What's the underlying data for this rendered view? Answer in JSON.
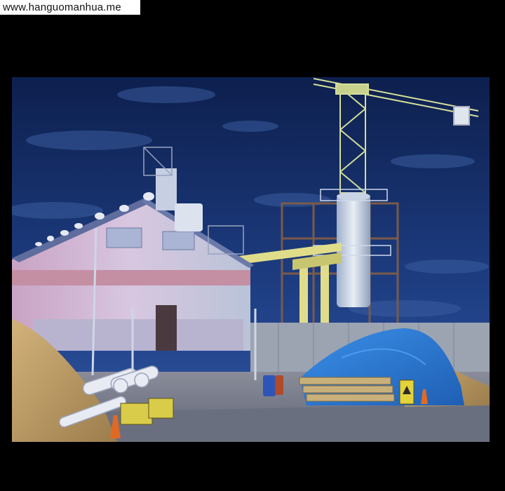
{
  "watermark": {
    "text": "www.hanguomanhua.me"
  },
  "scene": {
    "description_tags": [
      "night-sky-icon",
      "factory-building-icon",
      "tower-crane-icon",
      "sand-pile-icon",
      "blue-tarp-icon",
      "pipes-icon",
      "traffic-cone-icon",
      "warning-sign-icon"
    ],
    "colors": {
      "sky_top": "#0f2457",
      "sky_bottom": "#2a4f9a",
      "sand": "#c7a46a",
      "tarp": "#2f7ed6",
      "crane": "#d7e0a2",
      "ground": "#7b7f92"
    }
  }
}
